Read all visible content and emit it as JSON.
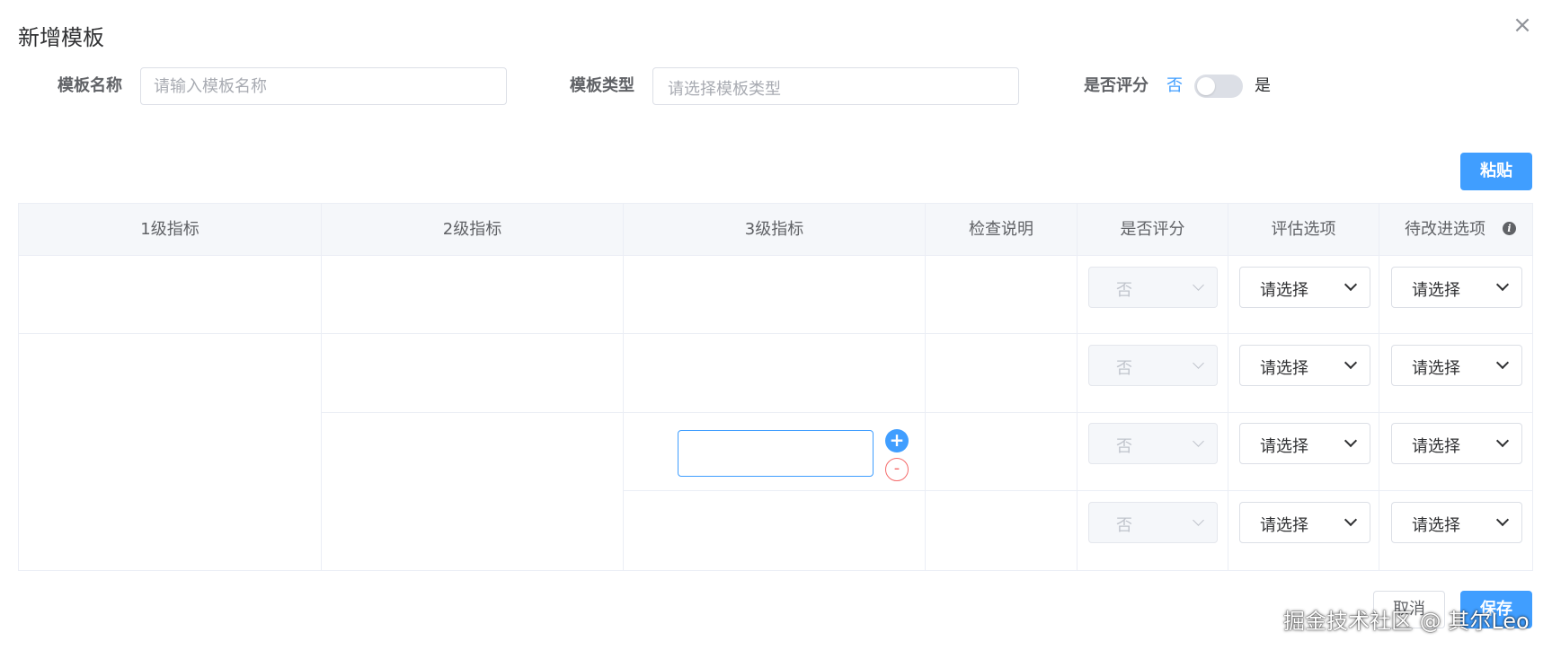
{
  "dialog": {
    "title": "新增模板",
    "close_icon": "close-icon"
  },
  "form": {
    "name_label": "模板名称",
    "name_placeholder": "请输入模板名称",
    "type_label": "模板类型",
    "type_placeholder": "请选择模板类型",
    "score_label": "是否评分",
    "switch_off_text": "否",
    "switch_on_text": "是",
    "switch_on": false
  },
  "toolbar": {
    "paste_label": "粘贴"
  },
  "table": {
    "headers": [
      "1级指标",
      "2级指标",
      "3级指标",
      "检查说明",
      "是否评分",
      "评估选项",
      "待改进选项"
    ],
    "header_info_icon": "info-icon",
    "rows": [
      {
        "score": "否",
        "eval": "请选择",
        "improve": "请选择"
      },
      {
        "score": "否",
        "eval": "请选择",
        "improve": "请选择"
      },
      {
        "score": "否",
        "eval": "请选择",
        "improve": "请选择"
      },
      {
        "score": "否",
        "eval": "请选择",
        "improve": "请选择"
      }
    ],
    "add_symbol": "+",
    "remove_symbol": "-"
  },
  "footer": {
    "cancel_label": "取消",
    "save_label": "保存"
  },
  "watermark": "掘金技术社区 @ 其尔Leo",
  "colors": {
    "primary": "#409eff",
    "danger": "#f56c6c",
    "border": "#dcdfe6",
    "header_bg": "#f5f7fa"
  }
}
